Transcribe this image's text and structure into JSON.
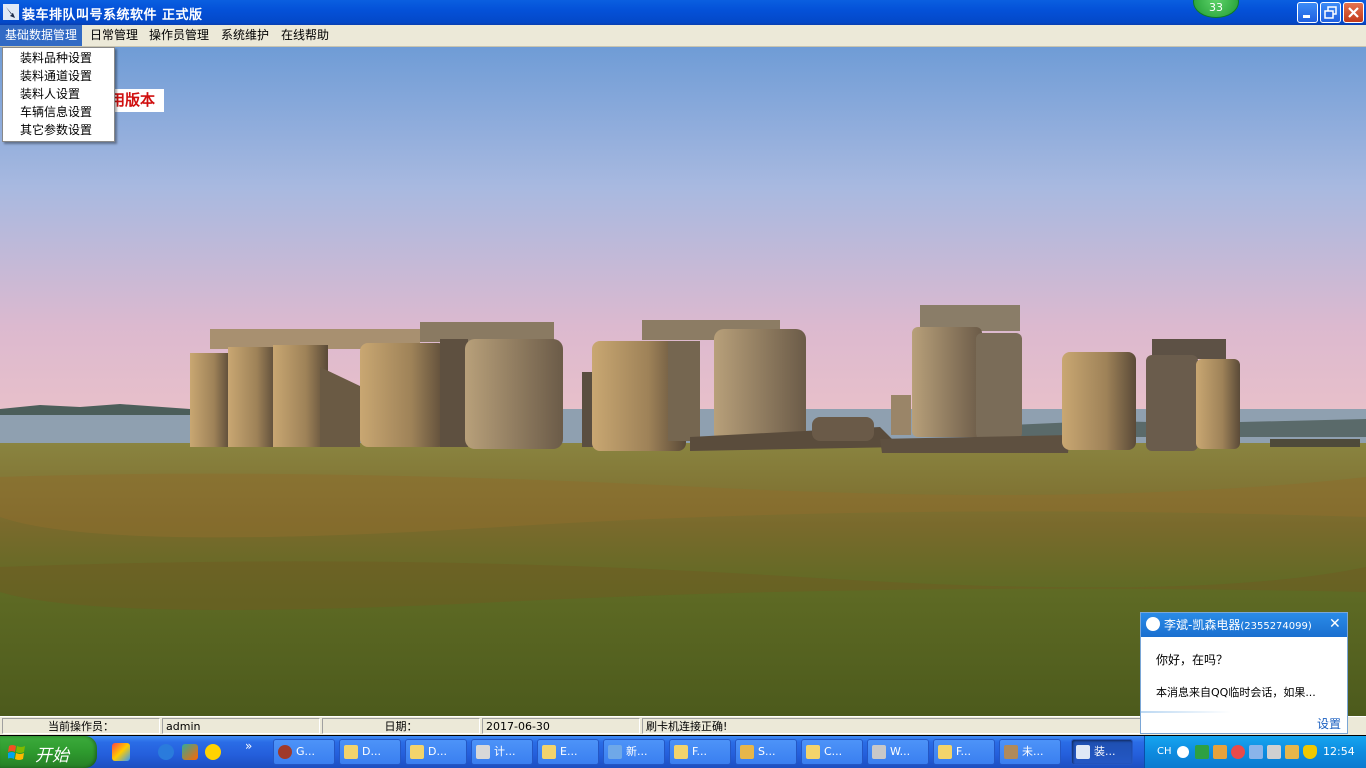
{
  "window": {
    "title": "装车排队叫号系统软件  正式版",
    "badge": "33"
  },
  "menu": {
    "items": [
      "基础数据管理",
      "日常管理",
      "操作员管理",
      "系统维护",
      "在线帮助"
    ],
    "dropdown": [
      "装料品种设置",
      "装料通道设置",
      "装料人设置",
      "车辆信息设置",
      "其它参数设置"
    ]
  },
  "main": {
    "version_label": "用版本"
  },
  "status": {
    "operator_label": "当前操作员：",
    "operator_value": "admin",
    "date_label": "日期：",
    "date_value": "2017-06-30",
    "message": "刷卡机连接正确!"
  },
  "taskbar": {
    "start_label": "开始",
    "quicklaunch_more": "»",
    "tasks": [
      "G...",
      "D...",
      "D...",
      "计...",
      "E...",
      "新...",
      "F...",
      "S...",
      "C...",
      "W...",
      "F...",
      "未...",
      "装..."
    ],
    "lang": "CH",
    "clock": "12:54"
  },
  "qq": {
    "name": "李斌-凯森电器",
    "number": "(2355274099)",
    "message1": "你好，在吗？",
    "message2": "本消息来自QQ临时会话，如果...",
    "settings": "设置"
  },
  "colors": {
    "titlebar": "#0451d8",
    "menu_active": "#316ac5",
    "version_text": "#d01010",
    "taskbar": "#245edb",
    "start": "#2e9a2e"
  }
}
